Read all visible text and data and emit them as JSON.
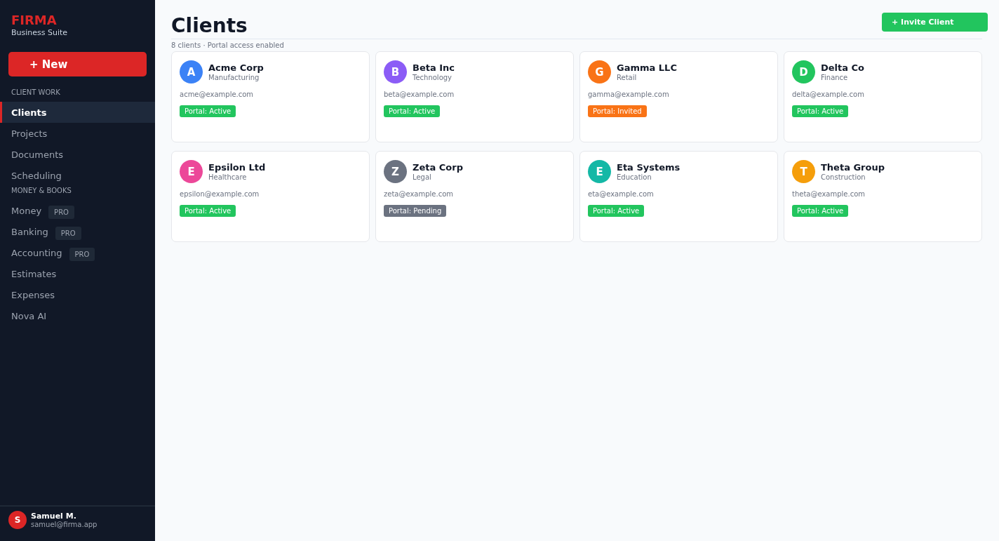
{
  "sidebar": {
    "brand": "FIRMA",
    "tagline": "Business Suite",
    "new_button": "+ New",
    "sections": [
      {
        "title": "CLIENT WORK",
        "items": [
          {
            "label": "Clients",
            "selected": true
          },
          {
            "label": "Projects",
            "selected": false
          },
          {
            "label": "Documents",
            "selected": false
          },
          {
            "label": "Scheduling",
            "selected": false
          }
        ]
      },
      {
        "title": "MONEY & BOOKS",
        "items": [
          {
            "label": "Money",
            "selected": false,
            "badge": "PRO"
          },
          {
            "label": "Banking",
            "selected": false,
            "badge": "PRO"
          },
          {
            "label": "Accounting",
            "selected": false,
            "badge": "PRO"
          },
          {
            "label": "Estimates",
            "selected": false
          },
          {
            "label": "Expenses",
            "selected": false
          },
          {
            "label": "Nova AI",
            "selected": false
          }
        ]
      }
    ],
    "user": {
      "initial": "S",
      "name": "Samuel M.",
      "email": "samuel@firma.app"
    }
  },
  "header": {
    "title": "Clients",
    "subtitle": "8 clients · Portal access enabled",
    "invite_button": "+ Invite Client"
  },
  "clients": [
    {
      "initial": "A",
      "name": "Acme Corp",
      "industry": "Manufacturing",
      "email": "acme@example.com",
      "color": "#3b82f6",
      "status": {
        "label": "Portal: Active",
        "color": "#22c55e"
      }
    },
    {
      "initial": "B",
      "name": "Beta Inc",
      "industry": "Technology",
      "email": "beta@example.com",
      "color": "#8b5cf6",
      "status": {
        "label": "Portal: Active",
        "color": "#22c55e"
      }
    },
    {
      "initial": "G",
      "name": "Gamma LLC",
      "industry": "Retail",
      "email": "gamma@example.com",
      "color": "#f97316",
      "status": {
        "label": "Portal: Invited",
        "color": "#f97316"
      }
    },
    {
      "initial": "D",
      "name": "Delta Co",
      "industry": "Finance",
      "email": "delta@example.com",
      "color": "#22c55e",
      "status": {
        "label": "Portal: Active",
        "color": "#22c55e"
      }
    },
    {
      "initial": "E",
      "name": "Epsilon Ltd",
      "industry": "Healthcare",
      "email": "epsilon@example.com",
      "color": "#ec4899",
      "status": {
        "label": "Portal: Active",
        "color": "#22c55e"
      }
    },
    {
      "initial": "Z",
      "name": "Zeta Corp",
      "industry": "Legal",
      "email": "zeta@example.com",
      "color": "#6b7280",
      "status": {
        "label": "Portal: Pending",
        "color": "#6b7280"
      }
    },
    {
      "initial": "E",
      "name": "Eta Systems",
      "industry": "Education",
      "email": "eta@example.com",
      "color": "#14b8a6",
      "status": {
        "label": "Portal: Active",
        "color": "#22c55e"
      }
    },
    {
      "initial": "T",
      "name": "Theta Group",
      "industry": "Construction",
      "email": "theta@example.com",
      "color": "#f59e0b",
      "status": {
        "label": "Portal: Active",
        "color": "#22c55e"
      }
    }
  ]
}
